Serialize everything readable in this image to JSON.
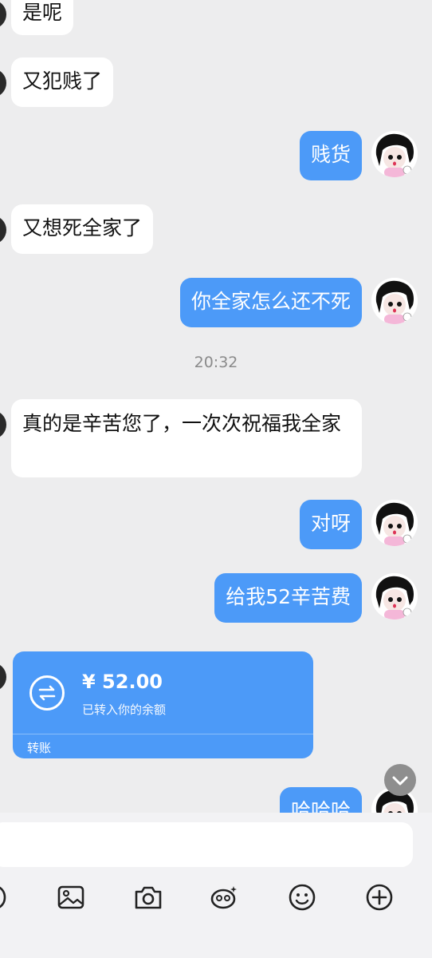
{
  "messages": [
    {
      "side": "in",
      "text": "是呢"
    },
    {
      "side": "in",
      "text": "又犯贱了"
    },
    {
      "side": "out",
      "text": "贱货"
    },
    {
      "side": "in",
      "text": "又想死全家了"
    },
    {
      "side": "out",
      "text": "你全家怎么还不死"
    },
    {
      "side": "time",
      "text": "20:32"
    },
    {
      "side": "in",
      "text": "真的是辛苦您了，一次次祝福我全家"
    },
    {
      "side": "out",
      "text": "对呀"
    },
    {
      "side": "out",
      "text": "给我52辛苦费"
    },
    {
      "side": "transfer",
      "amount": "¥ 52.00",
      "status": "已转入你的余额",
      "label": "转账"
    },
    {
      "side": "out",
      "text": "哈哈哈"
    }
  ],
  "input": {
    "placeholder": ""
  },
  "toolbar": {
    "icons": [
      "voice-icon",
      "image-icon",
      "camera-icon",
      "red-packet-icon",
      "emoji-icon",
      "plus-icon"
    ]
  },
  "colors": {
    "outgoing_bubble": "#4c9af8",
    "incoming_bubble": "#ffffff",
    "background": "#ededee"
  }
}
